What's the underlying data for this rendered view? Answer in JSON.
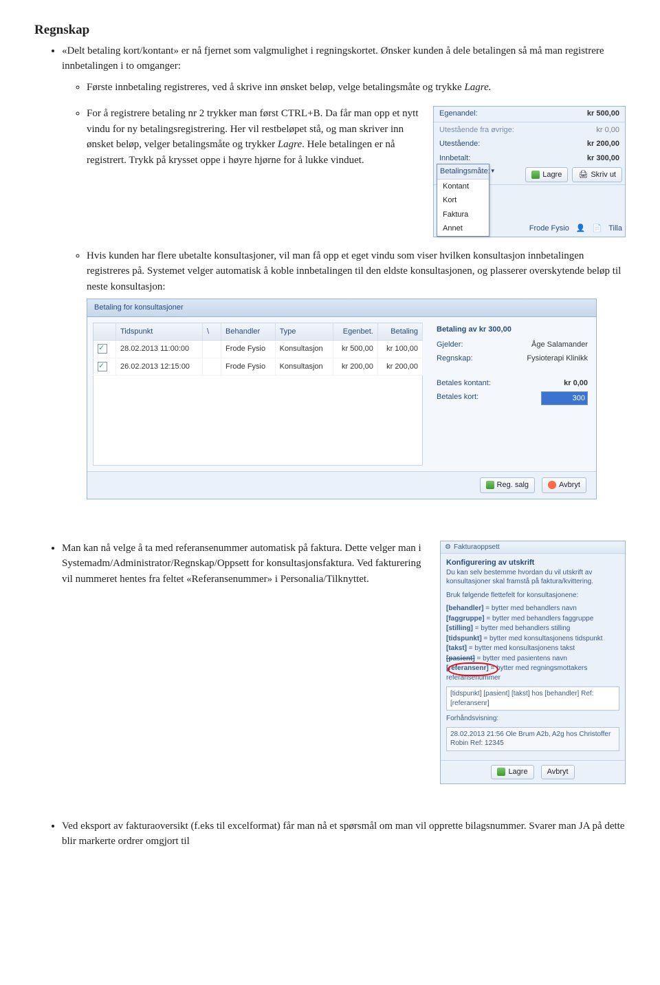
{
  "heading": "Regnskap",
  "bullet1": {
    "lead": "«Delt betaling kort/kontant» er nå fjernet som valgmulighet i regningskortet. Ønsker kunden å dele betalingen så må man registrere innbetalingen i to omganger:",
    "sub1": "Første innbetaling registreres, ved å skrive inn ønsket beløp, velge betalingsmåte og trykke ",
    "sub1_em": "Lagre.",
    "sub2": "For å registrere betaling nr 2 trykker man først CTRL+B. Da får man opp et nytt vindu for ny betalingsregistrering. Her vil restbeløpet stå, og man skriver inn ønsket beløp, velger betalingsmåte og trykker ",
    "sub2_em": "Lagre",
    "sub2_tail": ". Hele betalingen er nå registrert. Trykk på krysset oppe i høyre hjørne for å lukke vinduet.",
    "sub3": "Hvis kunden har flere ubetalte konsultasjoner, vil man få opp et eget vindu som viser hvilken konsultasjon innbetalingen registreres på. Systemet velger automatisk å koble innbetalingen til den eldste konsultasjonen, og plasserer overskytende beløp til neste konsultasjon:"
  },
  "panel1": {
    "rows": [
      {
        "label": "Egenandel:",
        "value": "kr 500,00"
      },
      {
        "label": "Utestående fra øvrige:",
        "value": "kr 0,00"
      },
      {
        "label": "Utestående:",
        "value": "kr 200,00"
      },
      {
        "label": "Innbetalt:",
        "value": "kr 300,00"
      }
    ],
    "dd_field": "Betalingsmåte:",
    "dd_items": [
      "Kontant",
      "Kort",
      "Faktura",
      "Annet"
    ],
    "lagre": "Lagre",
    "skriv": "Skriv ut",
    "footer_name": "Frode Fysio",
    "footer_tag": "Tilla"
  },
  "panel2": {
    "title": "Betaling for konsultasjoner",
    "cols": [
      "",
      "Tidspunkt",
      "Behandler",
      "Type",
      "Egenbet.",
      "Betaling"
    ],
    "rows": [
      {
        "chk": true,
        "t": "28.02.2013 11:00:00",
        "b": "Frode Fysio",
        "ty": "Konsultasjon",
        "e": "kr 500,00",
        "p": "kr 100,00"
      },
      {
        "chk": true,
        "t": "26.02.2013 12:15:00",
        "b": "Frode Fysio",
        "ty": "Konsultasjon",
        "e": "kr 200,00",
        "p": "kr 200,00"
      }
    ],
    "side": {
      "hdr": "Betaling av kr 300,00",
      "gjelder_l": "Gjelder:",
      "gjelder_v": "Åge Salamander",
      "regnskap_l": "Regnskap:",
      "regnskap_v": "Fysioterapi Klinikk",
      "kontant_l": "Betales kontant:",
      "kontant_v": "kr 0,00",
      "kort_l": "Betales kort:",
      "kort_v": "300"
    },
    "reg": "Reg. salg",
    "avbryt": "Avbryt"
  },
  "bullet2": "Man kan nå velge å ta med referansenummer automatisk på faktura. Dette velger man i Systemadm/Administrator/Regnskap/Oppsett for konsultasjonsfaktura. Ved fakturering vil nummeret hentes fra feltet «Referansenummer» i Personalia/Tilknyttet.",
  "panel3": {
    "title": "Fakturaoppsett",
    "h": "Konfigurering av utskrift",
    "intro": "Du kan selv bestemme hvordan du vil utskrift av konsultasjoner skal framstå på faktura/kvittering.",
    "intro2": "Bruk følgende flettefelt for konsultasjonene:",
    "tags": [
      {
        "k": "[behandler]",
        "d": " = bytter med behandlers navn"
      },
      {
        "k": "[faggruppe]",
        "d": " = bytter med behandlers faggruppe"
      },
      {
        "k": "[stilling]",
        "d": " = bytter med behandlers stilling"
      },
      {
        "k": "[tidspunkt]",
        "d": " = bytter med konsultasjonens tidspunkt"
      },
      {
        "k": "[takst]",
        "d": " = bytter med konsultasjonens takst"
      },
      {
        "k": "[pasient]",
        "d": " = bytter med pasientens navn",
        "strike": true
      },
      {
        "k": "[referansenr]",
        "d": " = bytter med regningsmottakers referansenummer",
        "circled": true
      }
    ],
    "templ": "[tidspunkt] [pasient] [takst] hos [behandler] Ref: [referansenr]",
    "preview_l": "Forhåndsvisning:",
    "preview": "28.02.2013 21:56 Ole Brum A2b, A2g hos Christoffer Robin Ref: 12345",
    "lagre": "Lagre",
    "avbryt": "Avbryt"
  },
  "bullet3": "Ved eksport av fakturaoversikt (f.eks til excelformat) får man nå et spørsmål om man vil opprette bilagsnummer. Svarer man JA på dette blir markerte ordrer omgjort til"
}
